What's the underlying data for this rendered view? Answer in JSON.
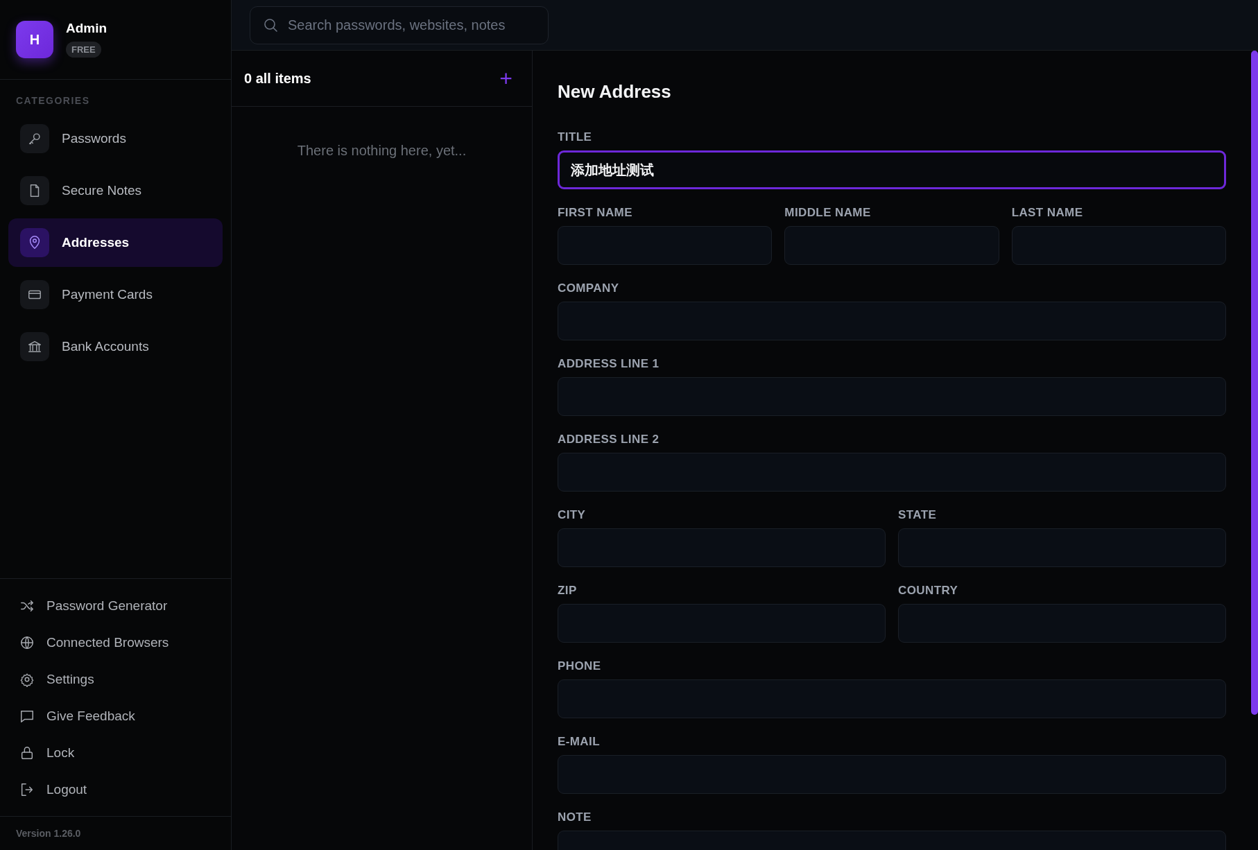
{
  "user": {
    "avatar": "H",
    "name": "Admin",
    "plan": "FREE"
  },
  "sidebar": {
    "heading": "CATEGORIES",
    "items": [
      {
        "label": "Passwords",
        "selected": false
      },
      {
        "label": "Secure Notes",
        "selected": false
      },
      {
        "label": "Addresses",
        "selected": true
      },
      {
        "label": "Payment Cards",
        "selected": false
      },
      {
        "label": "Bank Accounts",
        "selected": false
      }
    ],
    "tools": [
      {
        "label": "Password Generator"
      },
      {
        "label": "Connected Browsers"
      },
      {
        "label": "Settings"
      },
      {
        "label": "Give Feedback"
      },
      {
        "label": "Lock"
      },
      {
        "label": "Logout"
      }
    ],
    "version": "Version 1.26.0"
  },
  "search": {
    "placeholder": "Search passwords, websites, notes"
  },
  "list": {
    "count": "0 all items",
    "add": "+",
    "empty": "There is nothing here, yet..."
  },
  "form": {
    "title": "New Address",
    "rows": [
      [
        {
          "label": "TITLE",
          "value": "添加地址测试",
          "focused": true
        }
      ],
      [
        {
          "label": "FIRST NAME",
          "focused": false
        },
        {
          "label": "MIDDLE NAME",
          "focused": false
        },
        {
          "label": "LAST NAME",
          "focused": false
        }
      ],
      [
        {
          "label": "COMPANY",
          "focused": false
        }
      ],
      [
        {
          "label": "ADDRESS LINE 1",
          "focused": false
        }
      ],
      [
        {
          "label": "ADDRESS LINE 2",
          "focused": false
        }
      ],
      [
        {
          "label": "CITY",
          "focused": false
        },
        {
          "label": "STATE",
          "focused": false
        }
      ],
      [
        {
          "label": "ZIP",
          "focused": false
        },
        {
          "label": "COUNTRY",
          "focused": false
        }
      ],
      [
        {
          "label": "PHONE",
          "focused": false
        }
      ],
      [
        {
          "label": "E-MAIL",
          "focused": false
        }
      ],
      [
        {
          "label": "NOTE",
          "focused": false
        }
      ]
    ]
  }
}
